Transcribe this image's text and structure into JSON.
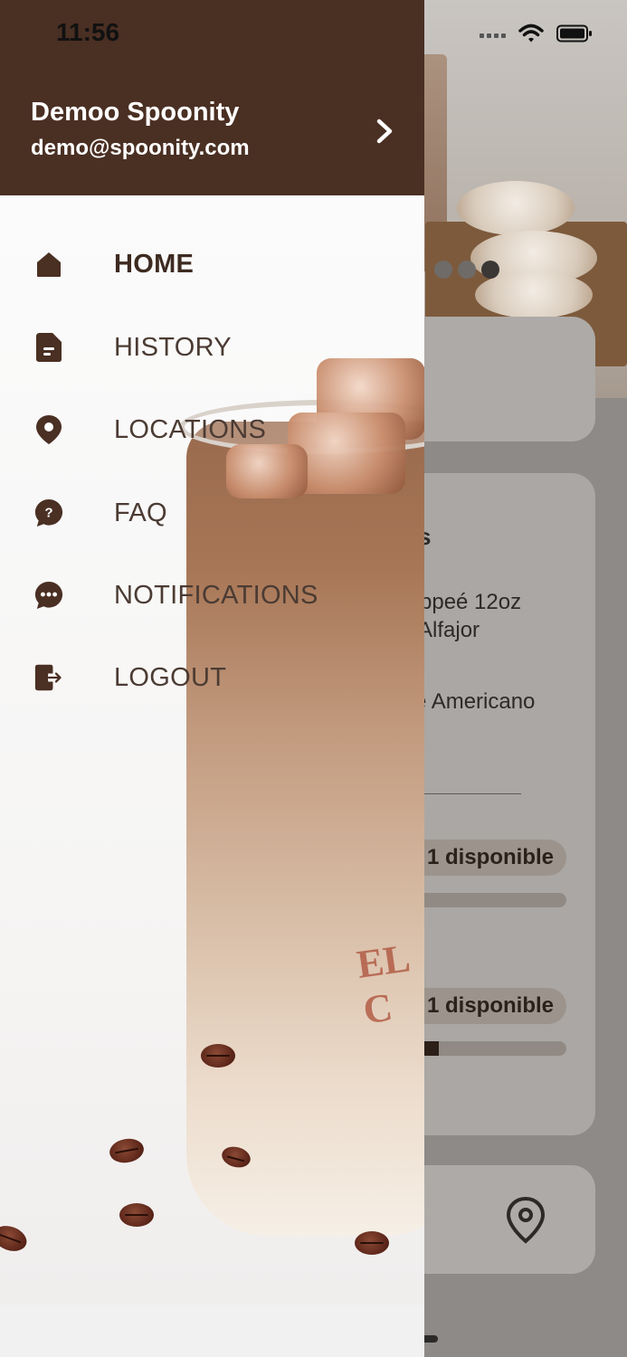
{
  "status_bar": {
    "time": "11:56"
  },
  "drawer": {
    "user_name": "Demoo Spoonity",
    "user_email": "demo@spoonity.com",
    "menu": [
      {
        "label": "HOME",
        "icon": "home-icon",
        "active": true
      },
      {
        "label": "HISTORY",
        "icon": "document-icon",
        "active": false
      },
      {
        "label": "LOCATIONS",
        "icon": "map-pin-icon",
        "active": false
      },
      {
        "label": "FAQ",
        "icon": "question-bubble-icon",
        "active": false
      },
      {
        "label": "NOTIFICATIONS",
        "icon": "chat-bubble-icon",
        "active": false
      },
      {
        "label": "LOGOUT",
        "icon": "logout-icon",
        "active": false
      }
    ]
  },
  "background": {
    "rewards_heading_fragment": "s",
    "reward_lines": [
      "ppeé 12oz",
      "Alfajor",
      "e Americano"
    ],
    "reward_status_1": "1 disponible",
    "reward_status_2": "1 disponible",
    "reward_progress_2": 0.2,
    "cup_brand_fragment": "EL C"
  },
  "colors": {
    "drawer_header": "#4a2f23",
    "menu_text": "#4b3b33",
    "menu_icon": "#4a2f23"
  }
}
